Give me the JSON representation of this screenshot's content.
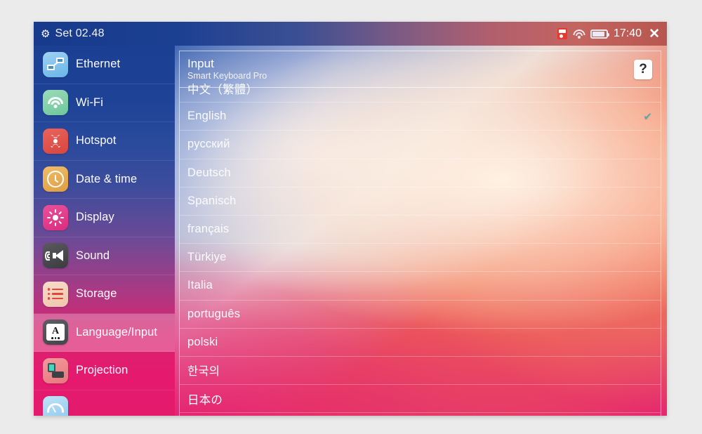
{
  "window": {
    "titlebar": {
      "gear_icon": "gear-icon",
      "title": "Set 02.48",
      "status": {
        "sim_icon": "sim-card-icon",
        "wifi_icon": "wifi-icon",
        "battery_icon": "battery-icon",
        "clock": "17:40",
        "close_label": "✕"
      }
    }
  },
  "sidebar": {
    "items": [
      {
        "label": "Ethernet",
        "icon": "ethernet-icon",
        "selected": false
      },
      {
        "label": "Wi-Fi",
        "icon": "wifi-icon",
        "selected": false
      },
      {
        "label": "Hotspot",
        "icon": "hotspot-icon",
        "selected": false
      },
      {
        "label": "Date & time",
        "icon": "clock-icon",
        "selected": false
      },
      {
        "label": "Display",
        "icon": "brightness-icon",
        "selected": false
      },
      {
        "label": "Sound",
        "icon": "speaker-icon",
        "selected": false
      },
      {
        "label": "Storage",
        "icon": "storage-icon",
        "selected": false
      },
      {
        "label": "Language/Input",
        "icon": "language-icon",
        "selected": true
      },
      {
        "label": "Projection",
        "icon": "projection-icon",
        "selected": false
      },
      {
        "label": "",
        "icon": "signal-icon",
        "selected": false
      }
    ]
  },
  "main": {
    "header": {
      "title": "Input",
      "subtitle": "Smart Keyboard Pro",
      "help_label": "?"
    },
    "languages": [
      {
        "name": "中文（繁體）",
        "checked": false
      },
      {
        "name": "English",
        "checked": true
      },
      {
        "name": "русский",
        "checked": false
      },
      {
        "name": "Deutsch",
        "checked": false
      },
      {
        "name": "Spanisch",
        "checked": false
      },
      {
        "name": "français",
        "checked": false
      },
      {
        "name": "Türkiye",
        "checked": false
      },
      {
        "name": "Italia",
        "checked": false
      },
      {
        "name": "português",
        "checked": false
      },
      {
        "name": "polski",
        "checked": false
      },
      {
        "name": "한국의",
        "checked": false
      },
      {
        "name": "日本の",
        "checked": false
      }
    ],
    "check_glyph": "✔"
  },
  "colors": {
    "titlebar_start": "#173a8c",
    "titlebar_end": "#b8564f",
    "sidebar_top": "#1b3f92",
    "sidebar_bottom": "#e31b6d",
    "selected_row": "rgba(255,255,255,0.28)",
    "check": "#5fa8a0",
    "page_bg": "#ebebeb"
  }
}
